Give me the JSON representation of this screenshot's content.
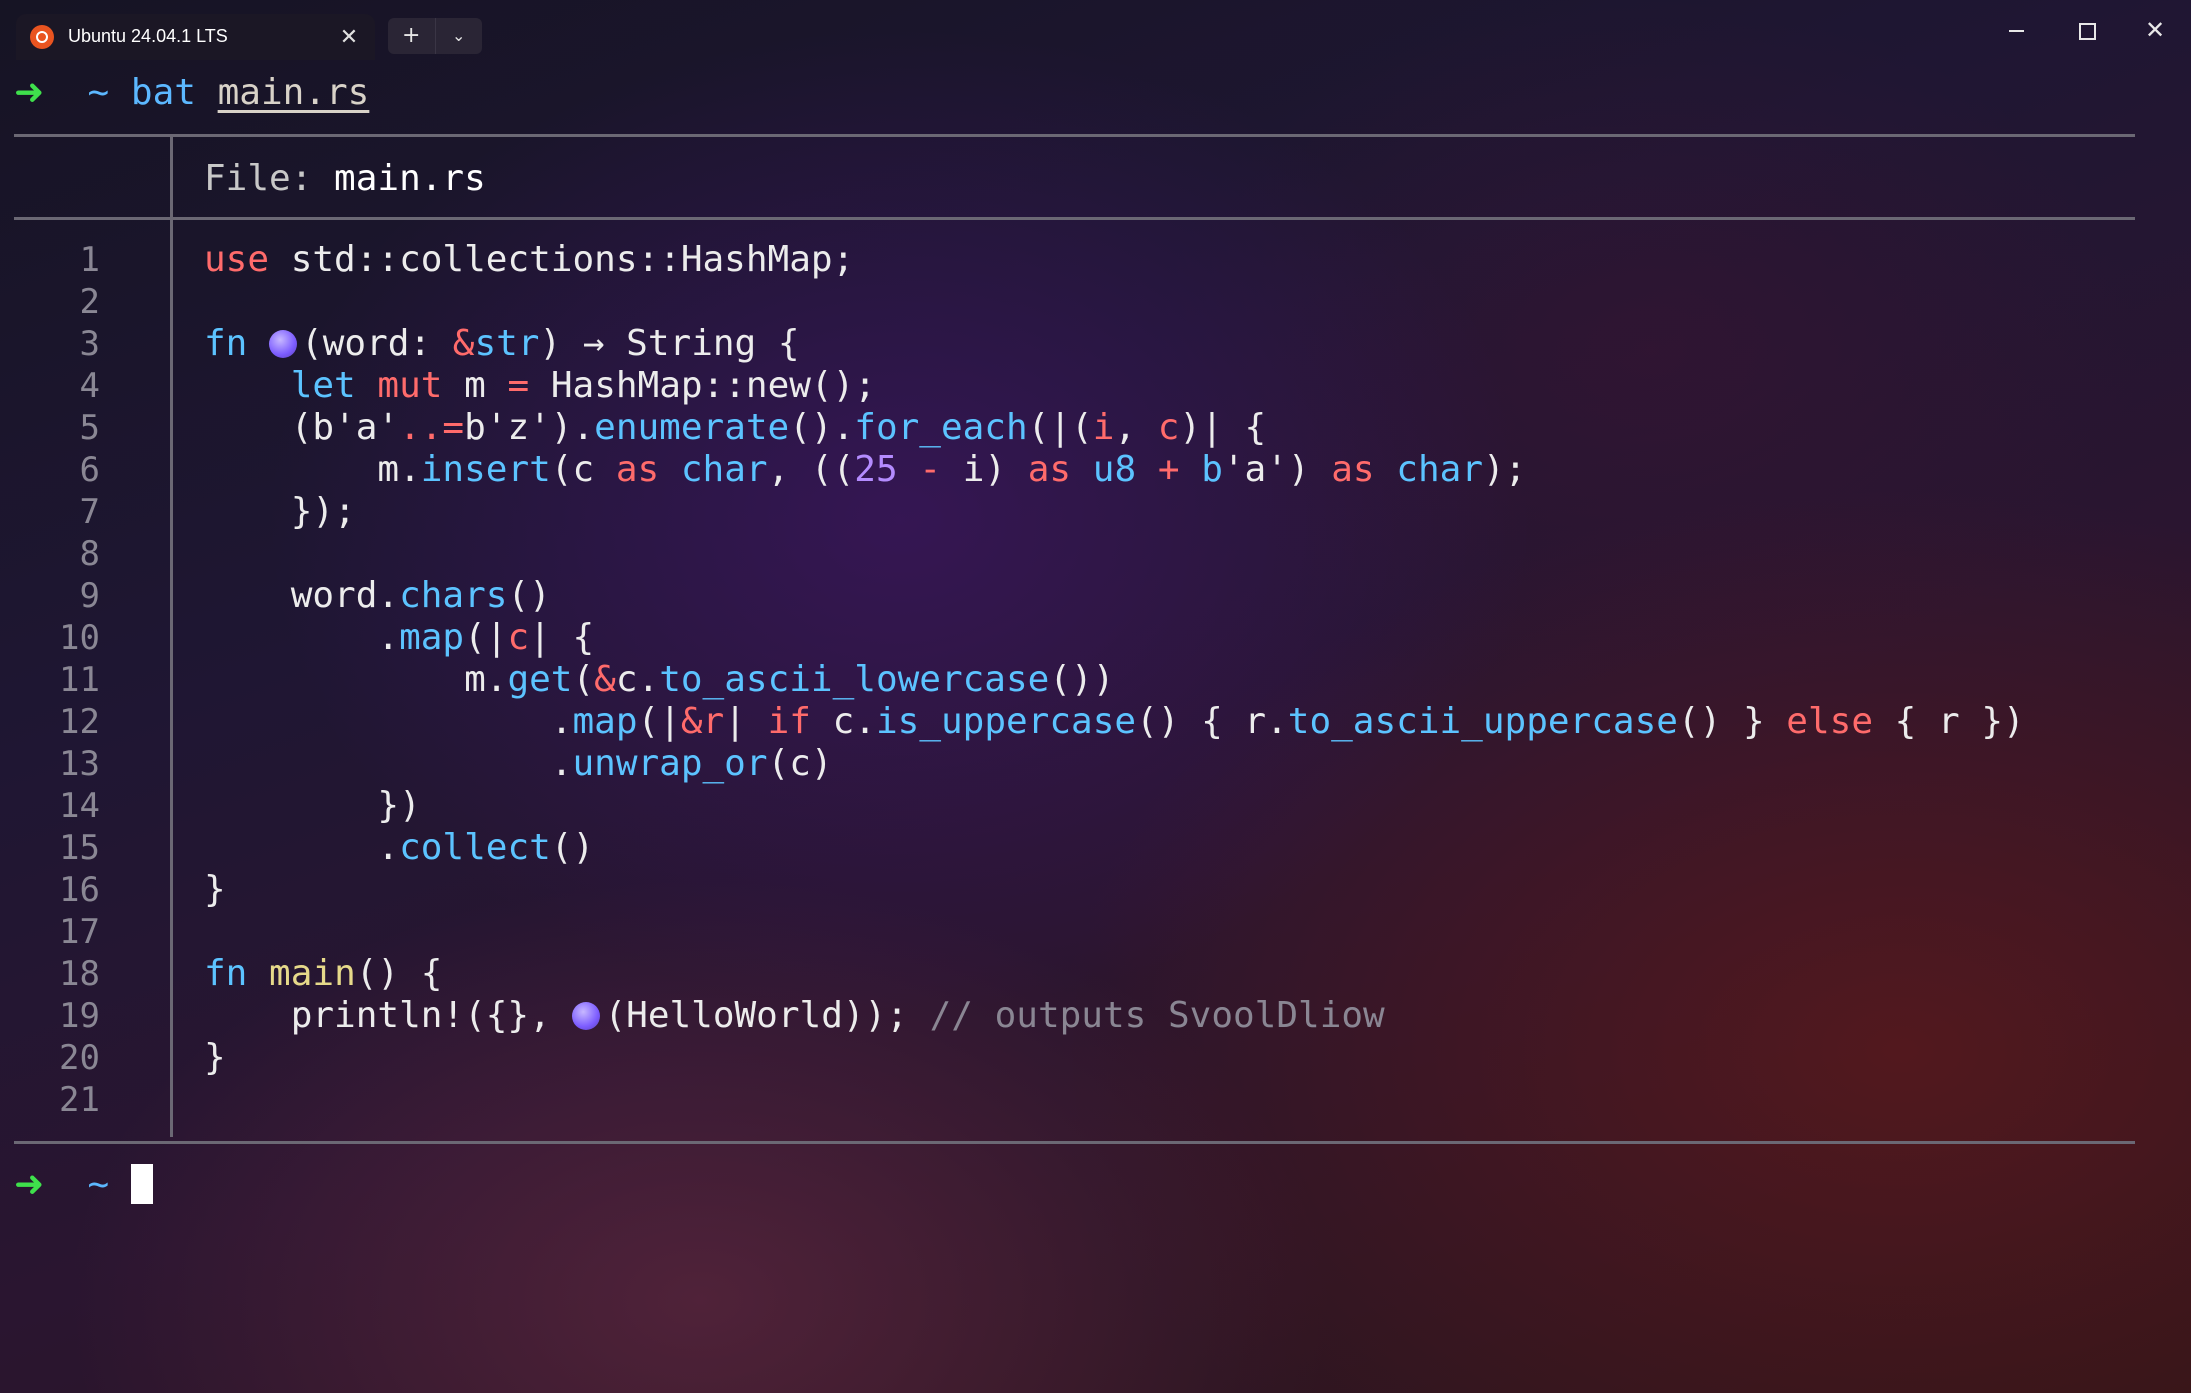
{
  "window": {
    "tab_title": "Ubuntu 24.04.1 LTS",
    "tab_close_symbol": "✕",
    "new_tab_symbol": "+",
    "dropdown_symbol": "⌄",
    "close_symbol": "✕"
  },
  "terminal": {
    "prompt_arrow": "➜",
    "prompt_dir": "~",
    "command": "bat",
    "command_arg": "main.rs",
    "file_label": "File: ",
    "file_name": "main.rs",
    "line_numbers": [
      "1",
      "2",
      "3",
      "4",
      "5",
      "6",
      "7",
      "8",
      "9",
      "10",
      "11",
      "12",
      "13",
      "14",
      "15",
      "16",
      "17",
      "18",
      "19",
      "20",
      "21"
    ],
    "code_lines": [
      "use std::collections::HashMap;",
      "",
      "fn 🔮(word: &str) -> String {",
      "    let mut m = HashMap::new();",
      "    (b'a'..=b'z').enumerate().for_each(|(i, c)| {",
      "        m.insert(c as char, ((25 - i) as u8 + b'a') as char);",
      "    });",
      "",
      "    word.chars()",
      "        .map(|c| {",
      "            m.get(&c.to_ascii_lowercase())",
      "                .map(|&r| if c.is_uppercase() { r.to_ascii_uppercase() } else { r })",
      "                .unwrap_or(c)",
      "        })",
      "        .collect()",
      "}",
      "",
      "fn main() {",
      "    println!({}, 🔮(HelloWorld)); // outputs SvoolDliow",
      "}",
      ""
    ]
  }
}
